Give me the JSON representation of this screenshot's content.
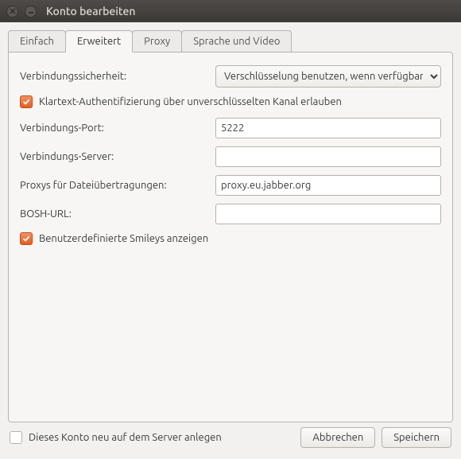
{
  "window": {
    "title": "Konto bearbeiten"
  },
  "tabs": {
    "einfach": "Einfach",
    "erweitert": "Erweitert",
    "proxy": "Proxy",
    "sprache": "Sprache und Video",
    "active": "erweitert"
  },
  "form": {
    "security_label": "Verbindungssicherheit:",
    "security_value": "Verschlüsselung benutzen, wenn verfügbar",
    "klartext_label": "Klartext-Authentifizierung über unverschlüsselten Kanal erlauben",
    "klartext_checked": true,
    "port_label": "Verbindungs-Port:",
    "port_value": "5222",
    "server_label": "Verbindungs-Server:",
    "server_value": "",
    "proxy_label": "Proxys für Dateiübertragungen:",
    "proxy_value": "proxy.eu.jabber.org",
    "bosh_label": "BOSH-URL:",
    "bosh_value": "",
    "smileys_label": "Benutzerdefinierte Smileys anzeigen",
    "smileys_checked": true
  },
  "footer": {
    "register_label": "Dieses Konto neu auf dem Server anlegen",
    "register_checked": false,
    "cancel": "Abbrechen",
    "save": "Speichern"
  }
}
